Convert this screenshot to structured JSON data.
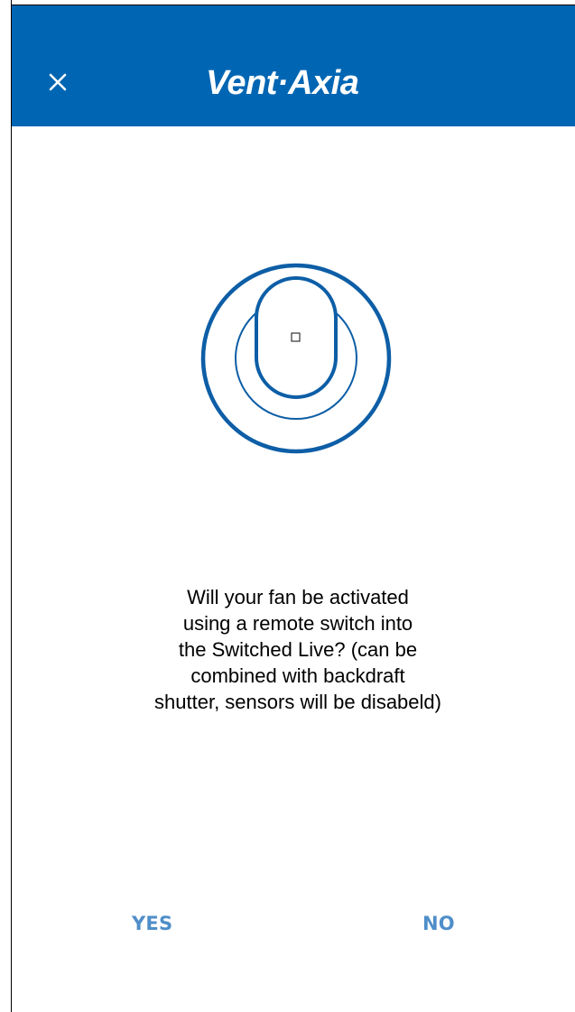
{
  "header": {
    "logo_text": "Vent·Axia",
    "close_icon": "close-icon",
    "background_color": "#0066b3"
  },
  "illustration": {
    "icon": "fan-device-icon",
    "color": "#0d5ea6"
  },
  "question": {
    "lines": [
      "Will your fan be activated",
      "using a remote switch into",
      "the Switched Live? (can be",
      "combined with backdraft",
      "shutter, sensors will be disabeld)"
    ]
  },
  "actions": {
    "yes_label": "YES",
    "no_label": "NO",
    "accent_color": "#4f8ec9"
  }
}
